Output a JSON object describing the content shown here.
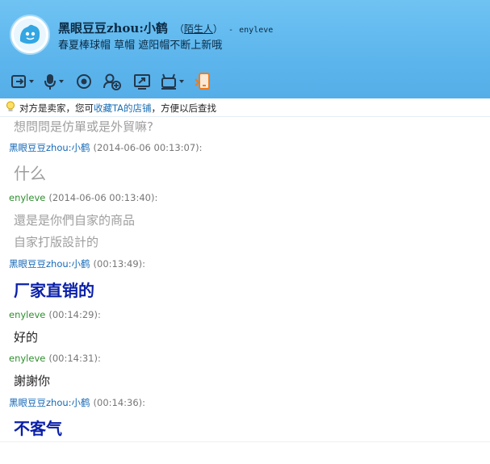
{
  "header": {
    "nickname": "黑眼豆豆zhou:小鹤",
    "stranger_open": "（",
    "stranger_label": "陌生人",
    "stranger_close": "）",
    "account_sep": "-",
    "account": "enyleve",
    "signature": "春夏棒球帽 草帽 遮阳帽不断上新哦"
  },
  "toolbar": {
    "items": [
      "transfer-file-icon",
      "voice-icon",
      "camera-icon",
      "add-contact-icon",
      "share-screen-icon",
      "remote-assist-icon",
      "phone-icon"
    ]
  },
  "notice": {
    "prefix": "对方是卖家，您可",
    "link": "收藏TA的店铺",
    "suffix": "，方便以后查找"
  },
  "messages": [
    {
      "lines": [
        "想問問是仿單或是外貿嘛?"
      ]
    },
    {
      "sender": "黑眼豆豆zhou:小鹤",
      "time": "(2014-06-06 00:13:07):",
      "lines": [
        "什么"
      ]
    },
    {
      "sender": "enyleve",
      "time": "(2014-06-06 00:13:40):",
      "lines": [
        "還是是你們自家的商品",
        "自家打版設計的"
      ]
    },
    {
      "sender": "黑眼豆豆zhou:小鹤",
      "time": "(00:13:49):",
      "lines": [
        "厂家直销的"
      ]
    },
    {
      "sender": "enyleve",
      "time": "(00:14:29):",
      "lines": [
        "好的"
      ]
    },
    {
      "sender": "enyleve",
      "time": "(00:14:31):",
      "lines": [
        "謝謝你"
      ]
    },
    {
      "sender": "黑眼豆豆zhou:小鹤",
      "time": "(00:14:36):",
      "lines": [
        "不客气"
      ]
    }
  ],
  "colors": {
    "header_bg": "#5cb5ec",
    "self_name": "#2f8f2f",
    "other_name": "#1569b8",
    "highlight_text": "#0a1fa8",
    "dim_text": "#9e9e9e"
  }
}
